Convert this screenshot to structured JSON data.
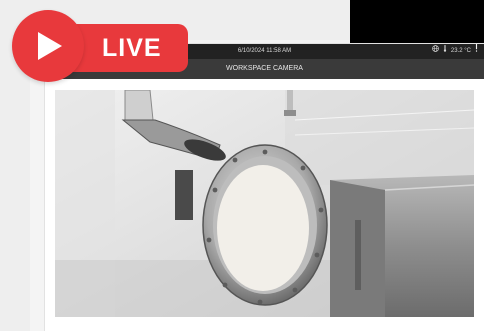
{
  "status_bar": {
    "datetime": "6/10/2024 11:58 AM",
    "temperature": "23.2 °C",
    "globe_icon": "globe-icon",
    "thermometer_icon": "thermometer-icon",
    "alert_icon": "alert-icon"
  },
  "screen": {
    "title": "WORKSPACE CAMERA"
  },
  "badge": {
    "label": "LIVE",
    "icon": "play-icon",
    "color": "#e8393c"
  }
}
